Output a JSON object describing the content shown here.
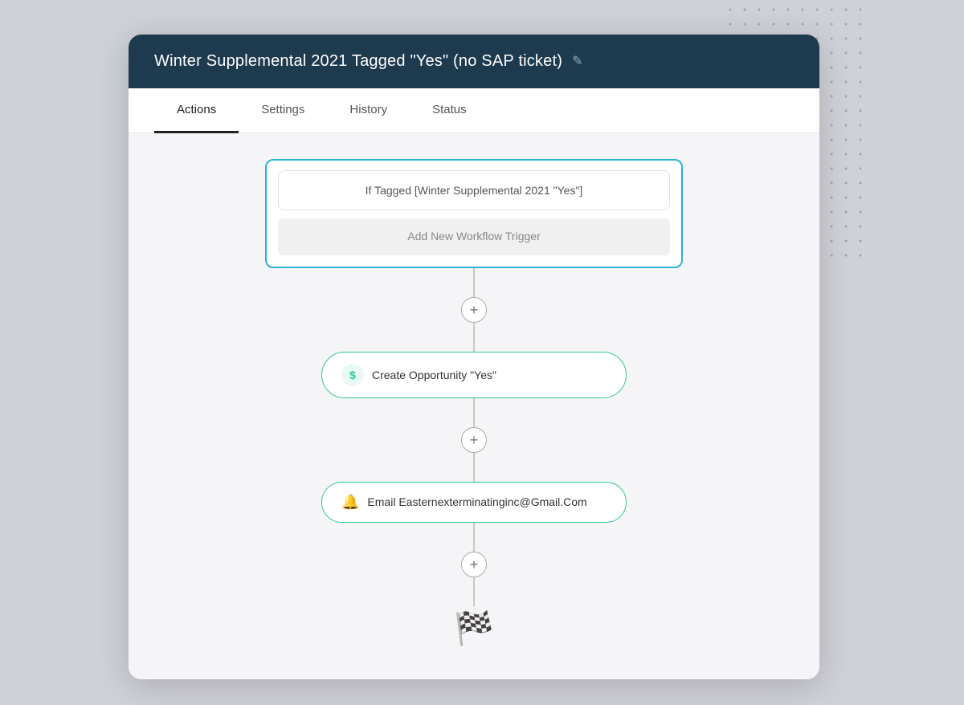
{
  "header": {
    "title": "Winter Supplemental 2021 Tagged \"Yes\" (no SAP ticket)",
    "edit_icon": "✎"
  },
  "tabs": [
    {
      "id": "actions",
      "label": "Actions",
      "active": true
    },
    {
      "id": "settings",
      "label": "Settings",
      "active": false
    },
    {
      "id": "history",
      "label": "History",
      "active": false
    },
    {
      "id": "status",
      "label": "Status",
      "active": false
    }
  ],
  "workflow": {
    "trigger_condition": "If Tagged [Winter Supplemental 2021 \"Yes\"]",
    "add_trigger_label": "Add New Workflow Trigger",
    "actions": [
      {
        "id": "create-opportunity",
        "icon_type": "dollar",
        "icon_label": "$",
        "label": "Create Opportunity \"Yes\""
      },
      {
        "id": "email-action",
        "icon_type": "bell",
        "icon_label": "🔔",
        "label": "Email Easternexterminatinginc@Gmail.Com"
      }
    ],
    "finish_icon": "🏁"
  },
  "colors": {
    "header_bg": "#1e3a4f",
    "trigger_border": "#2ab4d4",
    "action_border": "#2ecc8a",
    "tab_active_border": "#222222"
  }
}
